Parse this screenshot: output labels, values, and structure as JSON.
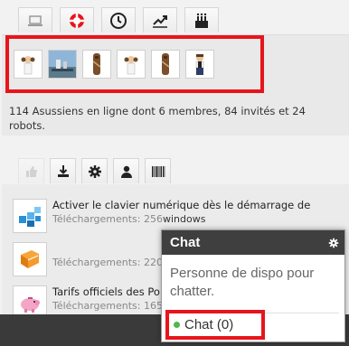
{
  "tabs": [
    {
      "name": "laptop-icon"
    },
    {
      "name": "lifebuoy-icon"
    },
    {
      "name": "clock-icon"
    },
    {
      "name": "chart-line-icon"
    },
    {
      "name": "cake-icon"
    }
  ],
  "online": {
    "avatars": [
      {
        "name": "avatar-leia"
      },
      {
        "name": "avatar-landscape"
      },
      {
        "name": "avatar-chewbacca"
      },
      {
        "name": "avatar-leia-2"
      },
      {
        "name": "avatar-chewbacca-2"
      },
      {
        "name": "avatar-han"
      }
    ],
    "text": "114 Asussiens en ligne dont 6 membres, 84 invités et 24 robots."
  },
  "tools": [
    {
      "name": "thumbs-up-icon",
      "disabled": true
    },
    {
      "name": "download-icon"
    },
    {
      "name": "gear-icon"
    },
    {
      "name": "user-icon"
    },
    {
      "name": "barcode-icon"
    }
  ],
  "downloads": [
    {
      "title": "Activer le clavier numérique dès le démarrage de",
      "meta": "Téléchargements: 256",
      "suffix": "windows",
      "icon": "cubes-icon"
    },
    {
      "title": "",
      "meta": "Téléchargements: 220",
      "suffix": "",
      "icon": "book-icon"
    },
    {
      "title": "Tarifs officiels des Por",
      "meta": "Téléchargements: 165",
      "suffix": "",
      "icon": "piggy-bank-icon"
    }
  ],
  "chat": {
    "title": "Chat",
    "message": "Personne de dispo pour chatter.",
    "status_label": "Chat (0)",
    "status_color": "#4cb94a",
    "header_color": "#3f3f3f"
  },
  "highlight_color": "#e8141c"
}
